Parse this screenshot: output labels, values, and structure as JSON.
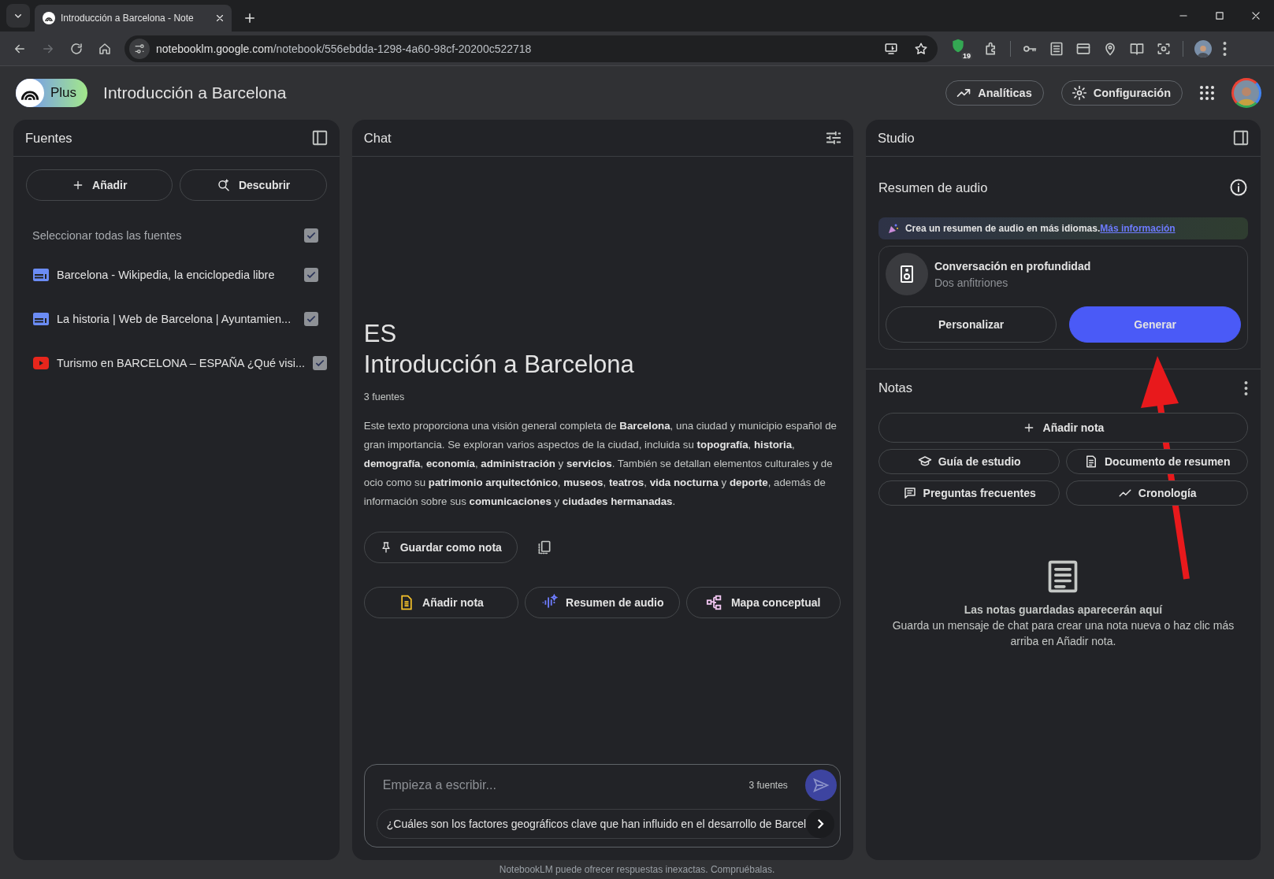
{
  "browser": {
    "tabs": [
      {
        "title": "Introducción a Barcelona - Note",
        "selected": true
      }
    ],
    "url_host": "notebooklm.google.com",
    "url_path": "/notebook/556ebdda-1298-4a60-98cf-20200c522718",
    "extension_badge": "19"
  },
  "header": {
    "plan_badge": "Plus",
    "notebook_title": "Introducción a Barcelona",
    "buttons": [
      {
        "label": "Analíticas",
        "kind": "analytics"
      },
      {
        "label": "Configuración",
        "kind": "settings"
      }
    ]
  },
  "sources": {
    "title": "Fuentes",
    "actions": [
      {
        "label": "Añadir",
        "kind": "add"
      },
      {
        "label": "Descubrir",
        "kind": "discover"
      }
    ],
    "select_all": {
      "label": "Seleccionar todas las fuentes",
      "checked": true
    },
    "items": [
      {
        "title": "Barcelona - Wikipedia, la enciclopedia libre",
        "kind": "web",
        "checked": true
      },
      {
        "title": "La historia | Web de Barcelona | Ayuntamien...",
        "kind": "web",
        "checked": true
      },
      {
        "title": "Turismo en BARCELONA – ESPAÑA ¿Qué visi...",
        "kind": "video",
        "checked": true
      }
    ]
  },
  "chat": {
    "title": "Chat",
    "emoji": "ES",
    "heading": "Introducción a Barcelona",
    "source_count": "3 fuentes",
    "summary": "Este texto proporciona una visión general completa de **Barcelona**, una ciudad y municipio español de gran importancia. Se exploran varios aspectos de la ciudad, incluida su **topografía**, **historia**, **demografía**, **economía**, **administración** y **servicios**. También se detallan elementos culturales y de ocio como su **patrimonio arquitectónico**, **museos**, **teatros**, **vida nocturna** y **deporte**, además de información sobre sus **comunicaciones** y **ciudades hermanadas**.",
    "save_button": "Guardar como nota",
    "actions": [
      {
        "label": "Añadir nota",
        "kind": "note"
      },
      {
        "label": "Resumen de audio",
        "kind": "audio"
      },
      {
        "label": "Mapa conceptual",
        "kind": "map"
      }
    ],
    "input": {
      "placeholder": "Empieza a escribir...",
      "source_count": "3 fuentes"
    },
    "suggestion": "¿Cuáles son los factores geográficos clave que han influido en el desarrollo de Barcel"
  },
  "studio": {
    "title": "Studio",
    "audio": {
      "title": "Resumen de audio",
      "banner_text": "Crea un resumen de audio en más idiomas.",
      "banner_link": "Más información",
      "card_title": "Conversación en profundidad",
      "card_subtitle": "Dos anfitriones",
      "customize_button": "Personalizar",
      "generate_button": "Generar"
    },
    "notes": {
      "title": "Notas",
      "add_button": "Añadir nota",
      "tools": [
        {
          "label": "Guía de estudio",
          "kind": "study"
        },
        {
          "label": "Documento de resumen",
          "kind": "brief"
        },
        {
          "label": "Preguntas frecuentes",
          "kind": "faq"
        },
        {
          "label": "Cronología",
          "kind": "timeline"
        }
      ],
      "empty_title": "Las notas guardadas aparecerán aquí",
      "empty_text": "Guarda un mensaje de chat para crear una nota nueva o haz clic más arriba en Añadir nota."
    }
  },
  "footer": "NotebookLM puede ofrecer respuestas inexactas. Compruébalas."
}
